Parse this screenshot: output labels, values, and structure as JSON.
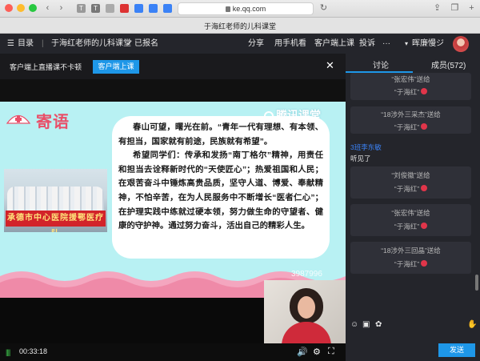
{
  "browser": {
    "url": "ke.qq.com",
    "tab_title": "于海红老师的儿科课堂"
  },
  "nav": {
    "menu_label": "目录",
    "course_title": "于海红老师的儿科课堂",
    "enrolled_label": "已报名",
    "share_label": "分享",
    "mobile_label": "用手机看",
    "client_label": "客户端上课",
    "report_label": "投诉",
    "more_label": "···",
    "username": "晖廉慢ジ"
  },
  "notice": {
    "text": "客户端上直播课不卡顿",
    "button": "客户端上课",
    "close": "✕"
  },
  "slide": {
    "title": "寄语",
    "brand": "腾讯课堂",
    "photo_banner": "承德市中心医院援鄂医疗队",
    "paragraphs": [
      "春山可望，曙光在前。“青年一代有理想、有本领、有担当，国家就有前途，民族就有希望”。",
      "希望同学们：传承和发扬“南丁格尔”精神，用责任和担当去诠释新时代的“天使匠心”；热爱祖国和人民；在艰苦奋斗中锤炼高贵品质，坚守人道、博爱、奉献精神，不怕辛苦，在为人民服务中不断增长“医者仁心”；在护理实践中练就过硬本领，努力做生命的守望者、健康的守护神。通过努力奋斗，活出自己的精彩人生。"
    ],
    "pip_id": "3987996"
  },
  "player": {
    "time": "00:33:18",
    "volume_icon": "🔊",
    "settings_icon": "⚙",
    "fullscreen_icon": "⛶"
  },
  "side": {
    "tab_discuss": "讨论",
    "tab_members": "成员(572)",
    "gifts": [
      {
        "from": "“张宏伟”送给",
        "to": "“于海红”"
      },
      {
        "from": "“18涉外三采杰”送给",
        "to": "“于海红”"
      },
      {
        "from": "“刘俊徽”送给",
        "to": "“于海红”"
      },
      {
        "from": "“张宏伟”送给",
        "to": "“于海红”"
      },
      {
        "from": "“18涉外三回晶”送给",
        "to": "“于海红”"
      }
    ],
    "chat": {
      "user": "3班李东敏",
      "text": "听见了"
    },
    "send_label": "发送"
  },
  "colors": {
    "accent": "#1e97e8",
    "dark_bg": "#24252b",
    "slide_bg": "#b8f1f3",
    "title_pink": "#e94f69"
  }
}
